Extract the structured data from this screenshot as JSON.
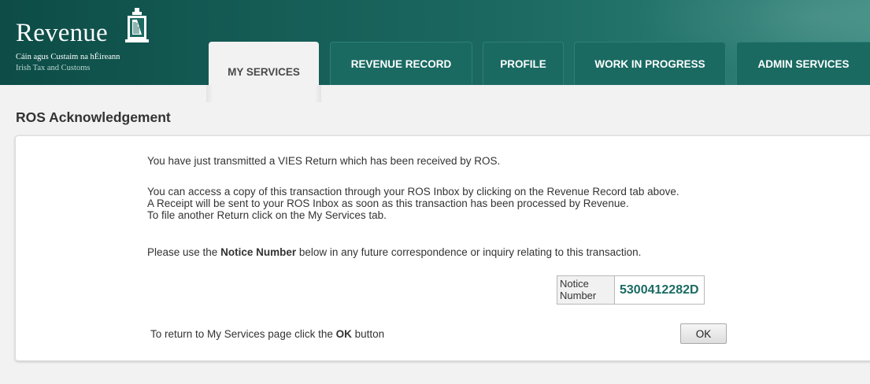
{
  "brand": {
    "name": "Revenue",
    "subtitle_irish": "Cáin agus Custaim na hÉireann",
    "subtitle_english": "Irish Tax and Customs",
    "icon": "harp-crest-icon"
  },
  "tabs": [
    {
      "label": "MY SERVICES",
      "active": true
    },
    {
      "label": "REVENUE RECORD",
      "active": false
    },
    {
      "label": "PROFILE",
      "active": false
    },
    {
      "label": "WORK IN PROGRESS",
      "active": false
    },
    {
      "label": "ADMIN SERVICES",
      "active": false
    }
  ],
  "page": {
    "title": "ROS Acknowledgement"
  },
  "acknowledgement": {
    "line1": "You have just transmitted a VIES Return which has been received by ROS.",
    "line2": "You can access a copy of this transaction through your ROS Inbox by clicking on the Revenue Record tab above.",
    "line3": "A Receipt will be sent to your ROS Inbox as soon as this transaction has been processed by Revenue.",
    "line4": "To file another Return click on the My Services tab.",
    "notice_prefix": "Please use the ",
    "notice_bold": "Notice Number",
    "notice_suffix": " below in any future correspondence or inquiry relating to this transaction.",
    "notice_label": "Notice Number",
    "notice_number": "5300412282D",
    "return_prefix": "To return to My Services page click the ",
    "return_bold": "OK",
    "return_suffix": " button",
    "ok_label": "OK"
  },
  "colors": {
    "header": "#155c55",
    "tab": "#1a6a62",
    "notice_number": "#1a6b62"
  }
}
